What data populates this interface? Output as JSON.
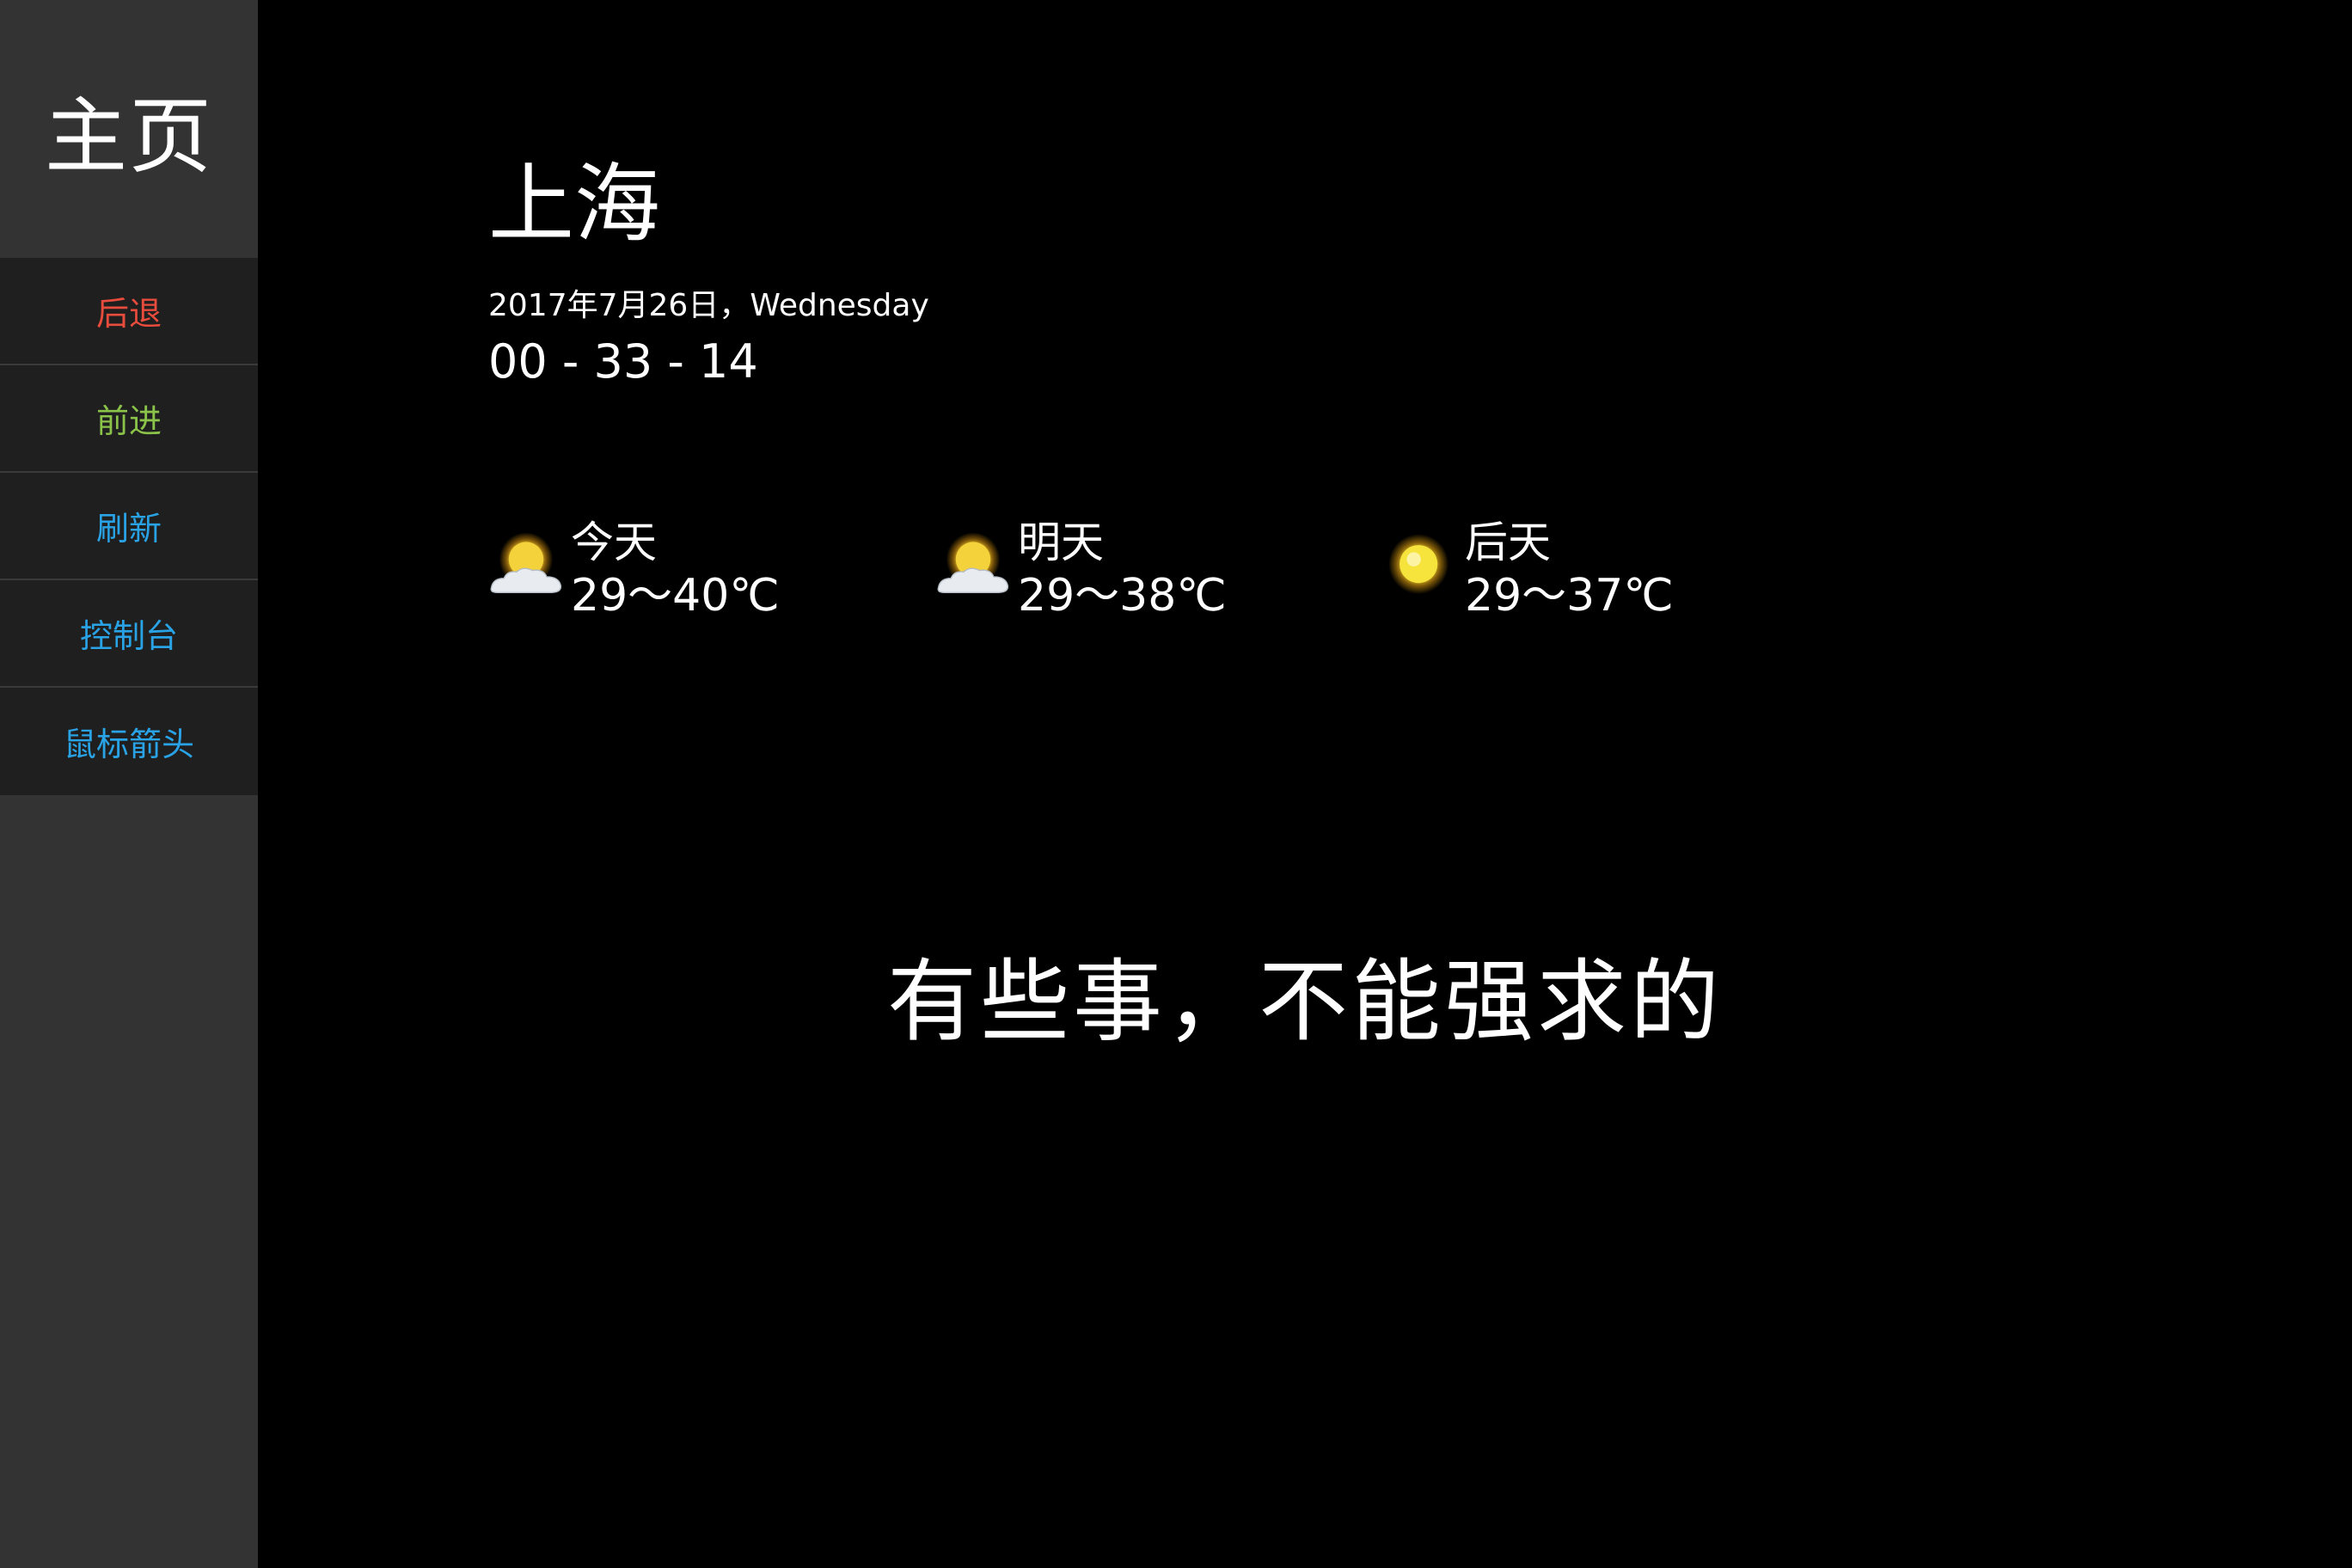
{
  "sidebar": {
    "title": "主页",
    "background": "#333333",
    "nav_background": "#1f1f1f",
    "items": [
      {
        "label": "后退",
        "color": "#e84c3d"
      },
      {
        "label": "前进",
        "color": "#8bc34a"
      },
      {
        "label": "刷新",
        "color": "#29a3e6"
      },
      {
        "label": "控制台",
        "color": "#29a3e6"
      },
      {
        "label": "鼠标箭头",
        "color": "#29a3e6"
      }
    ]
  },
  "main": {
    "city": "上海",
    "date": "2017年7月26日，Wednesday",
    "time": "00 - 33 - 14",
    "forecast": [
      {
        "day": "今天",
        "temp": "29～40℃",
        "icon": "sun-cloud-icon"
      },
      {
        "day": "明天",
        "temp": "29～38℃",
        "icon": "sun-cloud-icon"
      },
      {
        "day": "后天",
        "temp": "29～37℃",
        "icon": "sun-icon"
      }
    ],
    "quote": "有些事，不能强求的"
  }
}
